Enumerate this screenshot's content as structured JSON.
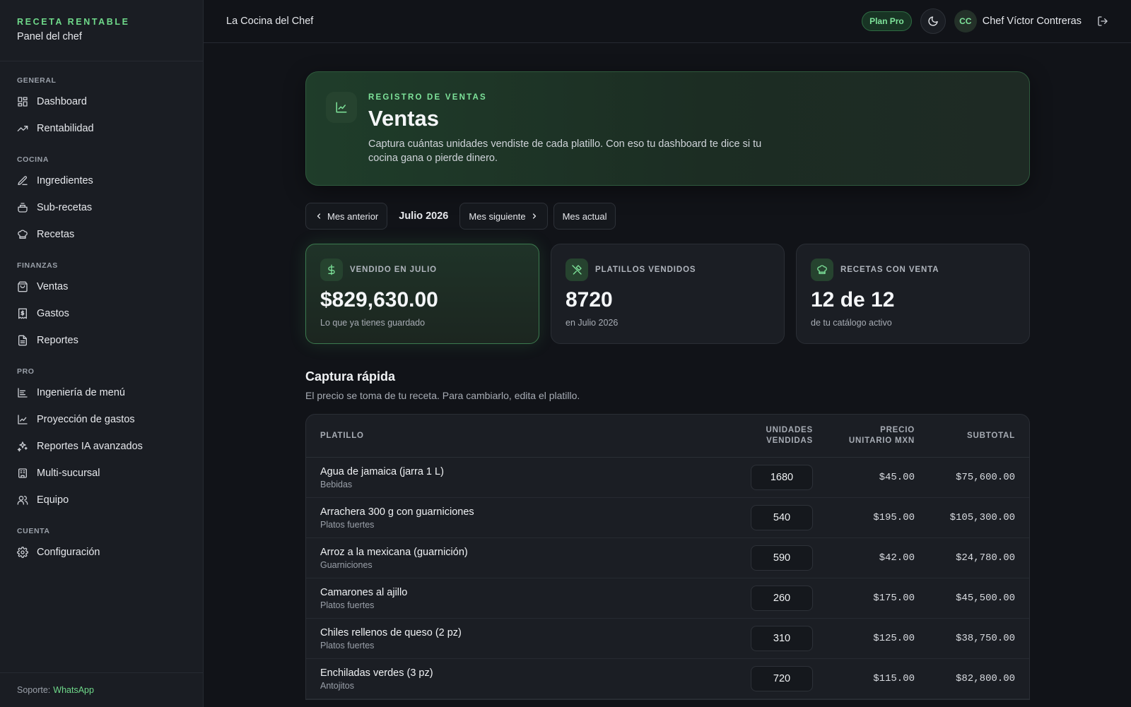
{
  "sidebar": {
    "brand_title": "RECETA RENTABLE",
    "brand_sub": "Panel del chef",
    "sections": [
      {
        "label": "GENERAL",
        "items": [
          {
            "label": "Dashboard",
            "icon": "dashboard-icon"
          },
          {
            "label": "Rentabilidad",
            "icon": "trending-up-icon"
          }
        ]
      },
      {
        "label": "COCINA",
        "items": [
          {
            "label": "Ingredientes",
            "icon": "pen-icon"
          },
          {
            "label": "Sub-recetas",
            "icon": "pot-icon"
          },
          {
            "label": "Recetas",
            "icon": "chef-hat-icon"
          }
        ]
      },
      {
        "label": "FINANZAS",
        "items": [
          {
            "label": "Ventas",
            "icon": "shopping-bag-icon"
          },
          {
            "label": "Gastos",
            "icon": "receipt-icon"
          },
          {
            "label": "Reportes",
            "icon": "file-icon"
          }
        ]
      },
      {
        "label": "PRO",
        "items": [
          {
            "label": "Ingeniería de menú",
            "icon": "list-icon"
          },
          {
            "label": "Proyección de gastos",
            "icon": "line-chart-icon"
          },
          {
            "label": "Reportes IA avanzados",
            "icon": "sparkles-icon"
          },
          {
            "label": "Multi-sucursal",
            "icon": "building-icon"
          },
          {
            "label": "Equipo",
            "icon": "users-icon"
          }
        ]
      },
      {
        "label": "CUENTA",
        "items": [
          {
            "label": "Configuración",
            "icon": "gear-icon"
          }
        ]
      }
    ],
    "support_label": "Soporte:",
    "support_link": "WhatsApp"
  },
  "header": {
    "restaurant": "La Cocina del Chef",
    "plan": "Plan Pro",
    "avatar_initials": "CC",
    "user_name": "Chef Víctor Contreras"
  },
  "hero": {
    "kicker": "REGISTRO DE VENTAS",
    "title": "Ventas",
    "description": "Captura cuántas unidades vendiste de cada platillo. Con eso tu dashboard te dice si tu cocina gana o pierde dinero."
  },
  "month_nav": {
    "prev": "Mes anterior",
    "current": "Julio 2026",
    "next": "Mes siguiente",
    "today": "Mes actual"
  },
  "stats": [
    {
      "label": "VENDIDO EN JULIO",
      "value": "$829,630.00",
      "sub": "Lo que ya tienes guardado",
      "icon": "dollar-icon"
    },
    {
      "label": "PLATILLOS VENDIDOS",
      "value": "8720",
      "sub": "en Julio 2026",
      "icon": "utensils-icon"
    },
    {
      "label": "RECETAS CON VENTA",
      "value": "12 de 12",
      "sub": "de tu catálogo activo",
      "icon": "chef-hat-icon"
    }
  ],
  "capture": {
    "title": "Captura rápida",
    "subtitle": "El precio se toma de tu receta. Para cambiarlo, edita el platillo."
  },
  "table": {
    "headers": {
      "name": "PLATILLO",
      "units_1": "UNIDADES",
      "units_2": "VENDIDAS",
      "price_1": "PRECIO",
      "price_2": "UNITARIO MXN",
      "subtotal": "SUBTOTAL"
    },
    "rows": [
      {
        "name": "Agua de jamaica (jarra 1 L)",
        "category": "Bebidas",
        "units": "1680",
        "price": "$45.00",
        "subtotal": "$75,600.00"
      },
      {
        "name": "Arrachera 300 g con guarniciones",
        "category": "Platos fuertes",
        "units": "540",
        "price": "$195.00",
        "subtotal": "$105,300.00"
      },
      {
        "name": "Arroz a la mexicana (guarnición)",
        "category": "Guarniciones",
        "units": "590",
        "price": "$42.00",
        "subtotal": "$24,780.00"
      },
      {
        "name": "Camarones al ajillo",
        "category": "Platos fuertes",
        "units": "260",
        "price": "$175.00",
        "subtotal": "$45,500.00"
      },
      {
        "name": "Chiles rellenos de queso (2 pz)",
        "category": "Platos fuertes",
        "units": "310",
        "price": "$125.00",
        "subtotal": "$38,750.00"
      },
      {
        "name": "Enchiladas verdes (3 pz)",
        "category": "Antojitos",
        "units": "720",
        "price": "$115.00",
        "subtotal": "$82,800.00"
      }
    ]
  }
}
